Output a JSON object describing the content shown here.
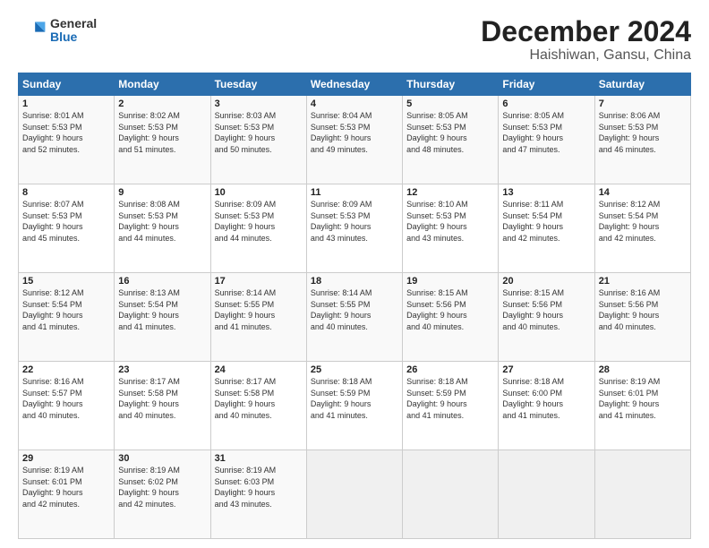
{
  "header": {
    "logo": {
      "line1": "General",
      "line2": "Blue"
    },
    "title": "December 2024",
    "subtitle": "Haishiwan, Gansu, China"
  },
  "days_of_week": [
    "Sunday",
    "Monday",
    "Tuesday",
    "Wednesday",
    "Thursday",
    "Friday",
    "Saturday"
  ],
  "weeks": [
    [
      {
        "day": "1",
        "sunrise": "8:01 AM",
        "sunset": "5:53 PM",
        "daylight_h": "9",
        "daylight_m": "52"
      },
      {
        "day": "2",
        "sunrise": "8:02 AM",
        "sunset": "5:53 PM",
        "daylight_h": "9",
        "daylight_m": "51"
      },
      {
        "day": "3",
        "sunrise": "8:03 AM",
        "sunset": "5:53 PM",
        "daylight_h": "9",
        "daylight_m": "50"
      },
      {
        "day": "4",
        "sunrise": "8:04 AM",
        "sunset": "5:53 PM",
        "daylight_h": "9",
        "daylight_m": "49"
      },
      {
        "day": "5",
        "sunrise": "8:05 AM",
        "sunset": "5:53 PM",
        "daylight_h": "9",
        "daylight_m": "48"
      },
      {
        "day": "6",
        "sunrise": "8:05 AM",
        "sunset": "5:53 PM",
        "daylight_h": "9",
        "daylight_m": "47"
      },
      {
        "day": "7",
        "sunrise": "8:06 AM",
        "sunset": "5:53 PM",
        "daylight_h": "9",
        "daylight_m": "46"
      }
    ],
    [
      {
        "day": "8",
        "sunrise": "8:07 AM",
        "sunset": "5:53 PM",
        "daylight_h": "9",
        "daylight_m": "45"
      },
      {
        "day": "9",
        "sunrise": "8:08 AM",
        "sunset": "5:53 PM",
        "daylight_h": "9",
        "daylight_m": "44"
      },
      {
        "day": "10",
        "sunrise": "8:09 AM",
        "sunset": "5:53 PM",
        "daylight_h": "9",
        "daylight_m": "44"
      },
      {
        "day": "11",
        "sunrise": "8:09 AM",
        "sunset": "5:53 PM",
        "daylight_h": "9",
        "daylight_m": "43"
      },
      {
        "day": "12",
        "sunrise": "8:10 AM",
        "sunset": "5:53 PM",
        "daylight_h": "9",
        "daylight_m": "43"
      },
      {
        "day": "13",
        "sunrise": "8:11 AM",
        "sunset": "5:54 PM",
        "daylight_h": "9",
        "daylight_m": "42"
      },
      {
        "day": "14",
        "sunrise": "8:12 AM",
        "sunset": "5:54 PM",
        "daylight_h": "9",
        "daylight_m": "42"
      }
    ],
    [
      {
        "day": "15",
        "sunrise": "8:12 AM",
        "sunset": "5:54 PM",
        "daylight_h": "9",
        "daylight_m": "41"
      },
      {
        "day": "16",
        "sunrise": "8:13 AM",
        "sunset": "5:54 PM",
        "daylight_h": "9",
        "daylight_m": "41"
      },
      {
        "day": "17",
        "sunrise": "8:14 AM",
        "sunset": "5:55 PM",
        "daylight_h": "9",
        "daylight_m": "41"
      },
      {
        "day": "18",
        "sunrise": "8:14 AM",
        "sunset": "5:55 PM",
        "daylight_h": "9",
        "daylight_m": "40"
      },
      {
        "day": "19",
        "sunrise": "8:15 AM",
        "sunset": "5:56 PM",
        "daylight_h": "9",
        "daylight_m": "40"
      },
      {
        "day": "20",
        "sunrise": "8:15 AM",
        "sunset": "5:56 PM",
        "daylight_h": "9",
        "daylight_m": "40"
      },
      {
        "day": "21",
        "sunrise": "8:16 AM",
        "sunset": "5:56 PM",
        "daylight_h": "9",
        "daylight_m": "40"
      }
    ],
    [
      {
        "day": "22",
        "sunrise": "8:16 AM",
        "sunset": "5:57 PM",
        "daylight_h": "9",
        "daylight_m": "40"
      },
      {
        "day": "23",
        "sunrise": "8:17 AM",
        "sunset": "5:58 PM",
        "daylight_h": "9",
        "daylight_m": "40"
      },
      {
        "day": "24",
        "sunrise": "8:17 AM",
        "sunset": "5:58 PM",
        "daylight_h": "9",
        "daylight_m": "40"
      },
      {
        "day": "25",
        "sunrise": "8:18 AM",
        "sunset": "5:59 PM",
        "daylight_h": "9",
        "daylight_m": "41"
      },
      {
        "day": "26",
        "sunrise": "8:18 AM",
        "sunset": "5:59 PM",
        "daylight_h": "9",
        "daylight_m": "41"
      },
      {
        "day": "27",
        "sunrise": "8:18 AM",
        "sunset": "6:00 PM",
        "daylight_h": "9",
        "daylight_m": "41"
      },
      {
        "day": "28",
        "sunrise": "8:19 AM",
        "sunset": "6:01 PM",
        "daylight_h": "9",
        "daylight_m": "41"
      }
    ],
    [
      {
        "day": "29",
        "sunrise": "8:19 AM",
        "sunset": "6:01 PM",
        "daylight_h": "9",
        "daylight_m": "42"
      },
      {
        "day": "30",
        "sunrise": "8:19 AM",
        "sunset": "6:02 PM",
        "daylight_h": "9",
        "daylight_m": "42"
      },
      {
        "day": "31",
        "sunrise": "8:19 AM",
        "sunset": "6:03 PM",
        "daylight_h": "9",
        "daylight_m": "43"
      },
      null,
      null,
      null,
      null
    ]
  ]
}
